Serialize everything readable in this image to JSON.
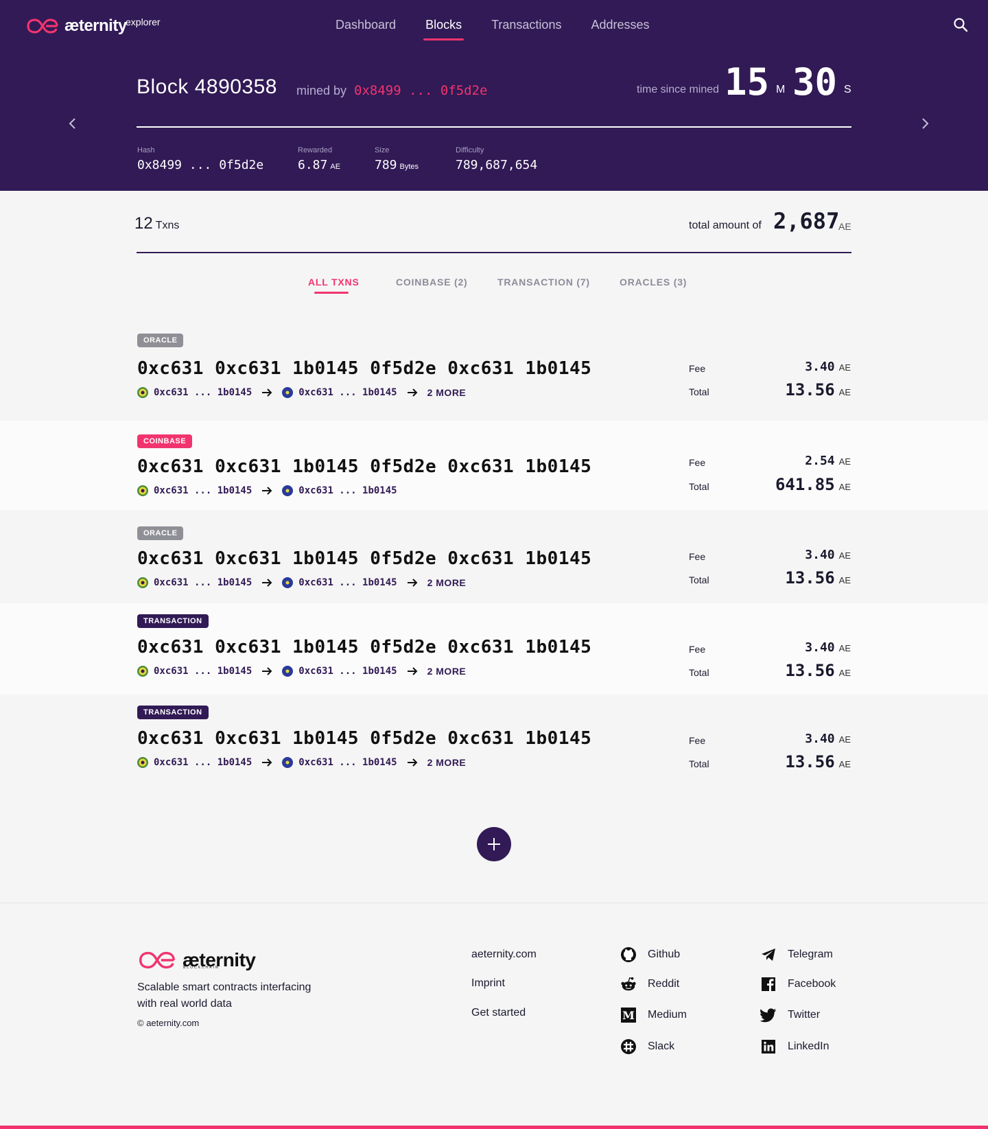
{
  "header": {
    "logo_text": "æternity",
    "logo_sub": "explorer",
    "nav": [
      "Dashboard",
      "Blocks",
      "Transactions",
      "Addresses"
    ],
    "active_nav": "Blocks"
  },
  "block": {
    "title": "Block 4890358",
    "mined_by_label": "mined by",
    "miner": "0x8499 ... 0f5d2e",
    "since_label": "time since mined",
    "minutes": "15",
    "minutes_unit": "M",
    "seconds": "30",
    "seconds_unit": "S",
    "stats": [
      {
        "label": "Hash",
        "value": "0x8499 ... 0f5d2e",
        "unit": ""
      },
      {
        "label": "Rewarded",
        "value": "6.87",
        "unit": "AE"
      },
      {
        "label": "Size",
        "value": "789",
        "unit": "Bytes"
      },
      {
        "label": "Difficulty",
        "value": "789,687,654",
        "unit": ""
      }
    ]
  },
  "summary": {
    "count": "12",
    "count_unit": "Txns",
    "total_label": "total amount of",
    "total_value": "2,687",
    "total_unit": "AE"
  },
  "tabs": [
    "ALL TXNS",
    "COINBASE (2)",
    "TRANSACTION (7)",
    "ORACLES (3)"
  ],
  "transactions": [
    {
      "type": "ORACLE",
      "hash": "0xc631 0xc631 1b0145 0f5d2e 0xc631 1b0145",
      "from": "0xc631 ... 1b0145",
      "to": "0xc631 ... 1b0145",
      "more": "2 MORE",
      "fee_label": "Fee",
      "fee": "3.40",
      "total_label": "Total",
      "total": "13.56",
      "unit": "AE"
    },
    {
      "type": "COINBASE",
      "hash": "0xc631 0xc631 1b0145 0f5d2e 0xc631 1b0145",
      "from": "0xc631 ... 1b0145",
      "to": "0xc631 ... 1b0145",
      "more": "",
      "fee_label": "Fee",
      "fee": "2.54",
      "total_label": "Total",
      "total": "641.85",
      "unit": "AE"
    },
    {
      "type": "ORACLE",
      "hash": "0xc631 0xc631 1b0145 0f5d2e 0xc631 1b0145",
      "from": "0xc631 ... 1b0145",
      "to": "0xc631 ... 1b0145",
      "more": "2 MORE",
      "fee_label": "Fee",
      "fee": "3.40",
      "total_label": "Total",
      "total": "13.56",
      "unit": "AE"
    },
    {
      "type": "TRANSACTION",
      "hash": "0xc631 0xc631 1b0145 0f5d2e 0xc631 1b0145",
      "from": "0xc631 ... 1b0145",
      "to": "0xc631 ... 1b0145",
      "more": "2 MORE",
      "fee_label": "Fee",
      "fee": "3.40",
      "total_label": "Total",
      "total": "13.56",
      "unit": "AE"
    },
    {
      "type": "TRANSACTION",
      "hash": "0xc631 0xc631 1b0145 0f5d2e 0xc631 1b0145",
      "from": "0xc631 ... 1b0145",
      "to": "0xc631 ... 1b0145",
      "more": "2 MORE",
      "fee_label": "Fee",
      "fee": "3.40",
      "total_label": "Total",
      "total": "13.56",
      "unit": "AE"
    }
  ],
  "footer": {
    "logo_text": "æternity",
    "logo_sub": "BLOCKCHAIN",
    "tagline": "Scalable smart contracts interfacing with real world data",
    "copyright": "© aeternity.com",
    "links": [
      "aeternity.com",
      "Imprint",
      "Get started"
    ],
    "social_left": [
      {
        "label": "Github",
        "icon": "github-icon"
      },
      {
        "label": "Reddit",
        "icon": "reddit-icon"
      },
      {
        "label": "Medium",
        "icon": "medium-icon"
      },
      {
        "label": "Slack",
        "icon": "slack-icon"
      }
    ],
    "social_right": [
      {
        "label": "Telegram",
        "icon": "telegram-icon"
      },
      {
        "label": "Facebook",
        "icon": "facebook-icon"
      },
      {
        "label": "Twitter",
        "icon": "twitter-icon"
      },
      {
        "label": "LinkedIn",
        "icon": "linkedin-icon"
      }
    ]
  },
  "colors": {
    "brand": "#311a55",
    "accent": "#f1346f",
    "oracle_badge": "#8f8f96"
  }
}
